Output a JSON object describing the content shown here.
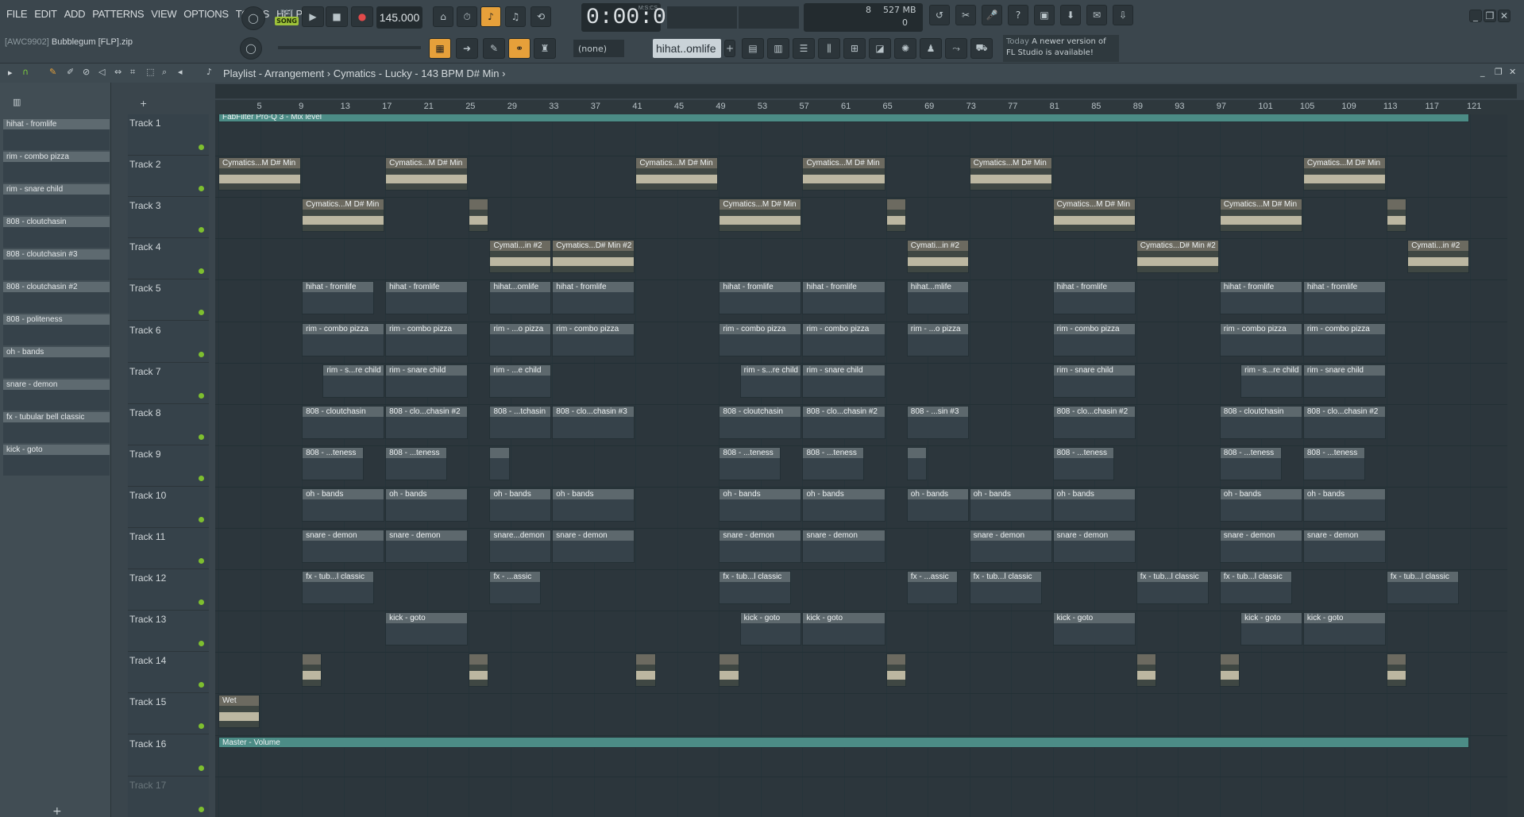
{
  "menu": [
    "FILE",
    "EDIT",
    "ADD",
    "PATTERNS",
    "VIEW",
    "OPTIONS",
    "TOOLS",
    "HELP"
  ],
  "transport": {
    "pat": "PAT",
    "song": "SONG",
    "tempo": "145.000",
    "time": "0:00:00",
    "mscs": "M:S:CS"
  },
  "cpu": {
    "voices": "8",
    "memory": "527 MB",
    "zero": "0"
  },
  "project": {
    "code": "[AWC9902]",
    "name": "Bubblegum [FLP].zip"
  },
  "pattern_selector": {
    "none": "(none)",
    "current": "hihat..omlife"
  },
  "hint": {
    "today": "Today",
    "text": "A newer version of FL Studio is available!"
  },
  "playlist": {
    "title": "Playlist - Arrangement",
    "pattern": "Cymatics - Lucky - 143 BPM D# Min"
  },
  "bars": [
    "5",
    "9",
    "13",
    "17",
    "21",
    "25",
    "29",
    "33",
    "37",
    "41",
    "45",
    "49",
    "53",
    "57",
    "61",
    "65",
    "69",
    "73",
    "77",
    "81",
    "85",
    "89",
    "93",
    "97",
    "101",
    "105",
    "109",
    "113",
    "117",
    "121"
  ],
  "browser": [
    "hihat - fromlife",
    "rim - combo pizza",
    "rim - snare child",
    "808 - cloutchasin",
    "808 - cloutchasin #3",
    "808 - cloutchasin #2",
    "808 - politeness",
    "oh - bands",
    "snare - demon",
    "fx - tubular bell classic",
    "kick - goto"
  ],
  "tracks": [
    "Track 1",
    "Track 2",
    "Track 3",
    "Track 4",
    "Track 5",
    "Track 6",
    "Track 7",
    "Track 8",
    "Track 9",
    "Track 10",
    "Track 11",
    "Track 12",
    "Track 13",
    "Track 14",
    "Track 15",
    "Track 16",
    "Track 17"
  ],
  "clips": {
    "automation1": "FabFilter Pro-Q 3 - Mix level",
    "cym": "Cymatics...M D# Min",
    "cym2a": "Cymati...in #2",
    "cym2b": "Cymatics...D# Min #2",
    "hihat": "hihat - fromlife",
    "hihat_short": "hihat...omlife",
    "hihat_short2": "hihat...mlife",
    "rim": "rim - combo pizza",
    "rim_short": "rim - ...o pizza",
    "rimsc": "rim - snare child",
    "rimsc_short": "rim - s...re child",
    "rimsc_short2": "rim - ...e child",
    "c808": "808 - cloutchasin",
    "c808_2": "808 - clo...chasin #2",
    "c808_3": "808 - clo...chasin #3",
    "c808_t": "808 - ...tchasin",
    "c808_s3": "808 - ...sin #3",
    "p808": "808 - ...teness",
    "oh": "oh - bands",
    "snare": "snare - demon",
    "snare_short": "snare...demon",
    "fx": "fx - tub...l classic",
    "fx_short": "fx - ...assic",
    "kick": "kick - goto",
    "wet": "Wet",
    "master": "Master - Volume"
  }
}
